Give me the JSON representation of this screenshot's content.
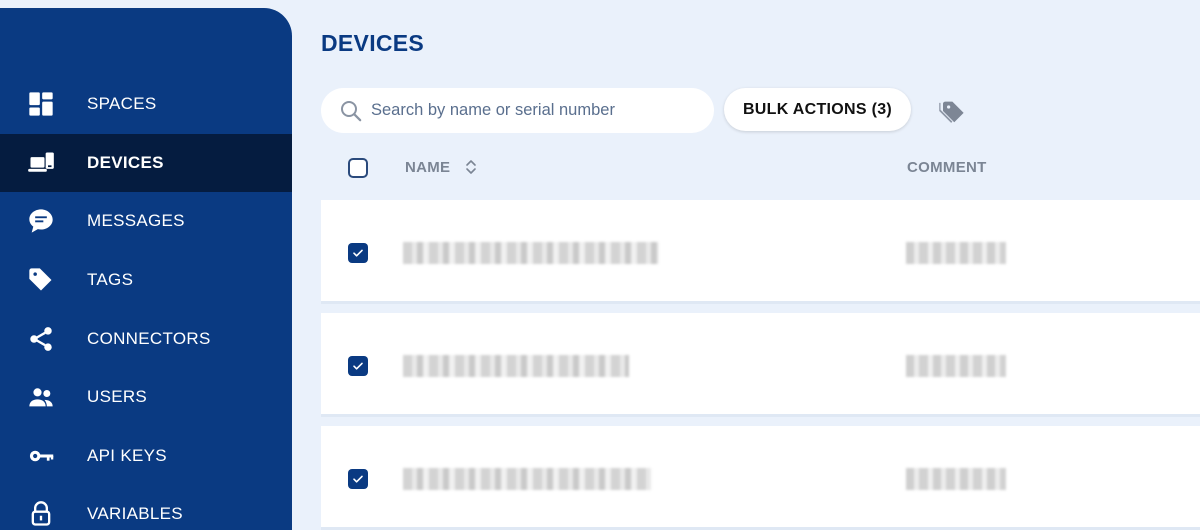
{
  "sidebar": {
    "items": [
      {
        "label": "SPACES",
        "icon": "spaces-icon",
        "active": false
      },
      {
        "label": "DEVICES",
        "icon": "devices-icon",
        "active": true
      },
      {
        "label": "MESSAGES",
        "icon": "messages-icon",
        "active": false
      },
      {
        "label": "TAGS",
        "icon": "tag-icon",
        "active": false
      },
      {
        "label": "CONNECTORS",
        "icon": "share-icon",
        "active": false
      },
      {
        "label": "USERS",
        "icon": "users-icon",
        "active": false
      },
      {
        "label": "API KEYS",
        "icon": "key-icon",
        "active": false
      },
      {
        "label": "VARIABLES",
        "icon": "lock-icon",
        "active": false
      }
    ]
  },
  "main": {
    "title": "DEVICES",
    "search": {
      "placeholder": "Search by name or serial number",
      "value": ""
    },
    "bulk_actions_label": "BULK ACTIONS (3)",
    "tag_button_icon": "tag-icon",
    "table": {
      "columns": [
        "NAME",
        "COMMENT"
      ],
      "rows": [
        {
          "checked": true,
          "name_blurred": true,
          "comment_blurred": true
        },
        {
          "checked": true,
          "name_blurred": true,
          "comment_blurred": true
        },
        {
          "checked": true,
          "name_blurred": true,
          "comment_blurred": true
        }
      ]
    }
  },
  "colors": {
    "sidebar_bg": "#0a3a82",
    "sidebar_active_bg": "#051c40",
    "page_bg": "#eaf1fb",
    "accent": "#0a3a82"
  }
}
